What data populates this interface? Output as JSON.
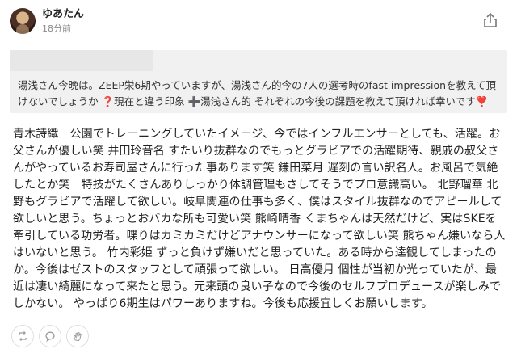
{
  "post": {
    "user_name": "ゆあたん",
    "time_ago": "18分前"
  },
  "question": {
    "text": "湯浅さん今晩は。ZEEP栄6期やっていますが、湯浅さん的今の7人の選考時のfast impressionを教えて頂けないでしょうか ❓現在と違う印象 ➕湯浅さん的 それぞれの今後の課題を教えて頂ければ幸いです❣️"
  },
  "answer": {
    "text": "青木詩織　公園でトレーニングしていたイメージ、今ではインフルエンサーとしても、活躍。お父さんが優しい笑 井田玲音名 すたいり抜群なのでもっとグラビアでの活躍期待、親戚の叔父さんがやっているお寿司屋さんに行った事あります笑 鎌田菜月 遅刻の言い訳名人。お風呂で気絶したとか笑　特技がたくさんありしっかり体調管理もさしてそうでプロ意識高い。 北野瑠華 北野もグラビアで活躍して欲しい。岐阜関連の仕事も多く、僕はスタイル抜群なのでアピールして欲しいと思う。ちょっとおバカな所も可愛い笑 熊崎晴香 くまちゃんは天然だけど、実はSKEを牽引している功労者。喋りはカミカミだけどアナウンサーになって欲しい笑 熊ちゃん嫌いなら人はいないと思う。 竹内彩姫 ずっと負けず嫌いだと思っていた。ある時から達観してしまったのか。今後はゼストのスタッフとして頑張って欲しい。 日高優月 個性が当初か光っていたが、最近は凄い綺麗になって来たと思う。元来頭の良い子なので今後のセルフプロデュースが楽しみでしかない。 やっぱり6期生はパワーありますね。今後も応援宜しくお願いします。"
  },
  "icons": {
    "share": "share-icon",
    "retweet": "retweet-icon",
    "comment": "comment-icon",
    "clap": "clap-icon"
  }
}
